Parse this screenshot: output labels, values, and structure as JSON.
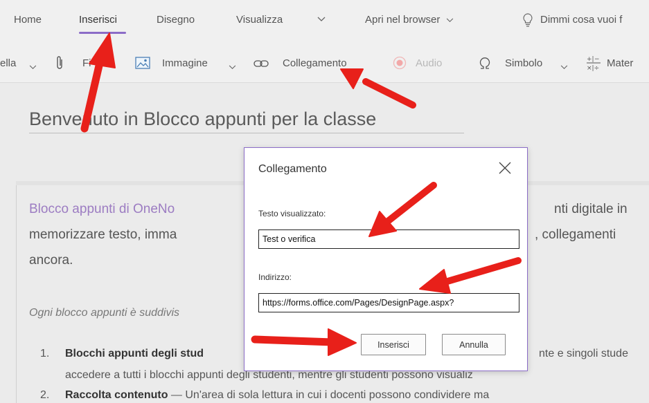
{
  "ribbon": {
    "tabs": [
      {
        "label": "Home"
      },
      {
        "label": "Inserisci"
      },
      {
        "label": "Disegno"
      },
      {
        "label": "Visualizza"
      }
    ],
    "open_in_browser": "Apri nel browser",
    "tell_me": "Dimmi cosa vuoi f"
  },
  "toolbar": {
    "table_partial": "ella",
    "file_partial": "Fi",
    "image": "Immagine",
    "link": "Collegamento",
    "audio": "Audio",
    "symbol": "Simbolo",
    "math_partial": "Mater"
  },
  "page": {
    "title": "Benvenuto in Blocco appunti per la classe",
    "intro_purple": "Blocco appunti di OneNo",
    "intro_right_1": "nti digitale in",
    "line2_left": "memorizzare testo, imma",
    "line2_right": ", collegamenti",
    "line3": "ancora.",
    "italic_line": "Ogni blocco appunti è suddivis",
    "item1_num": "1.",
    "item1_bold": "Blocchi appunti degli stud",
    "item1_right": "nte e singoli stude",
    "item1_line2": "accedere a tutti i blocchi appunti degli studenti, mentre gli studenti possono visualiz",
    "item2_num": "2.",
    "item2_bold": "Raccolta contenuto",
    "item2_rest": " — Un'area di sola lettura in cui i docenti possono condividere ma"
  },
  "dialog": {
    "title": "Collegamento",
    "display_text_label": "Testo visualizzato:",
    "display_text_value": "Test o verifica",
    "address_label": "Indirizzo:",
    "address_value": "https://forms.office.com/Pages/DesignPage.aspx?",
    "insert_label": "Inserisci",
    "cancel_label": "Annulla"
  },
  "colors": {
    "accent": "#8b6cc7",
    "annotation_arrow": "#e8201a"
  }
}
